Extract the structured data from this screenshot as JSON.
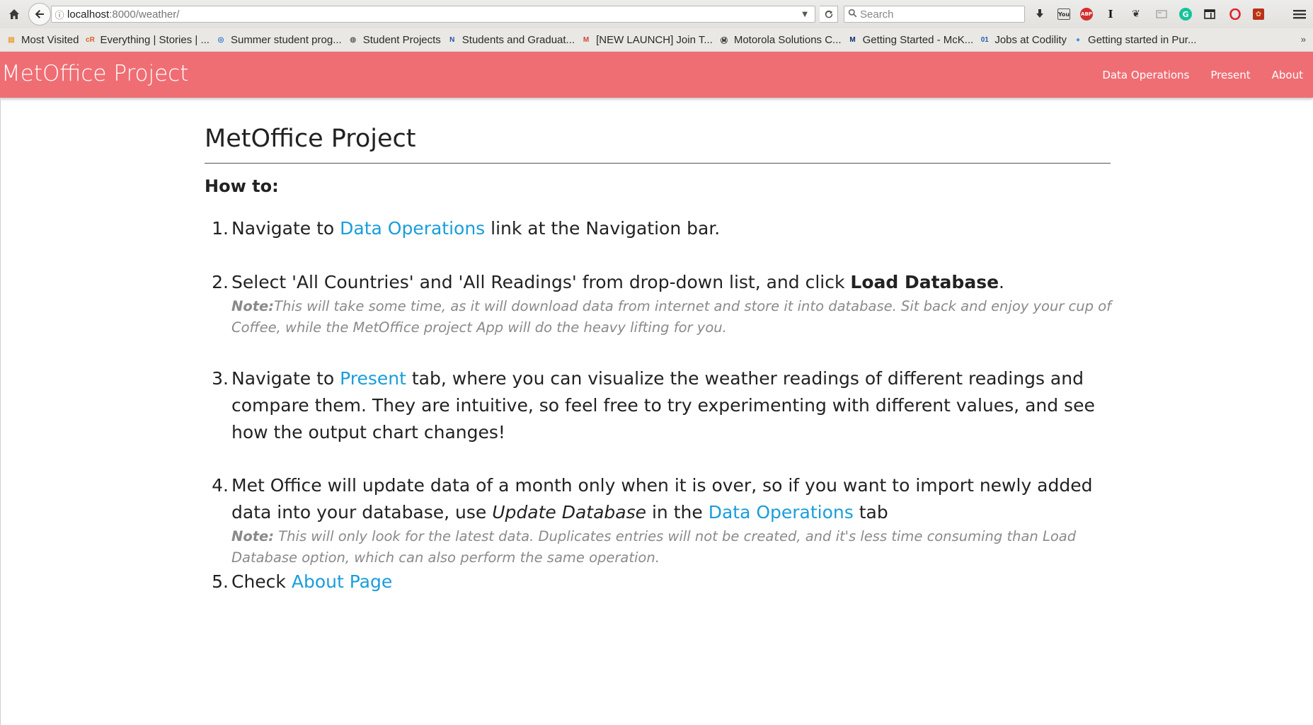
{
  "browser": {
    "url_host": "localhost",
    "url_path": ":8000/weather/",
    "search_placeholder": "Search",
    "bookmarks": [
      {
        "label": "Most Visited",
        "icon": "folder-icon",
        "color": "#e8a030"
      },
      {
        "label": "Everything | Stories | ...",
        "icon": "feed-icon",
        "color": "#e05a2a"
      },
      {
        "label": "Summer student prog...",
        "icon": "globe-icon",
        "color": "#3a7ad0"
      },
      {
        "label": "Student Projects",
        "icon": "globe-gray-icon",
        "color": "#666666"
      },
      {
        "label": "Students and Graduat...",
        "icon": "n-logo-icon",
        "color": "#2b4fa8"
      },
      {
        "label": "[NEW LAUNCH] Join T...",
        "icon": "gmail-icon",
        "color": "#d14836"
      },
      {
        "label": "Motorola Solutions C...",
        "icon": "motorola-icon",
        "color": "#111111"
      },
      {
        "label": "Getting Started - McK...",
        "icon": "mck-icon",
        "color": "#0b2c6b"
      },
      {
        "label": "Jobs at Codility",
        "icon": "codility-icon",
        "color": "#2a5db0"
      },
      {
        "label": "Getting started in Pur...",
        "icon": "globe-blue-icon",
        "color": "#4a90e2"
      }
    ]
  },
  "navbar": {
    "brand": "MetOffice Project",
    "links": [
      "Data Operations",
      "Present",
      "About"
    ],
    "color": "#ef6e74"
  },
  "main": {
    "title": "MetOffice Project",
    "howto": "How to:",
    "steps": [
      {
        "num": "1.",
        "parts": [
          "Navigate to ",
          "Data Operations",
          " link at the Navigation bar."
        ]
      },
      {
        "num": "2.",
        "parts": [
          "Select 'All Countries' and 'All Readings' from drop-down list, and click ",
          "Load Database",
          "."
        ],
        "note_label": "Note:",
        "note_text": "This will take some time, as it will download data from internet and store it into database. Sit back and enjoy your cup of Coffee, while the MetOffice project App will do the heavy lifting for you."
      },
      {
        "num": "3.",
        "parts": [
          "Navigate to ",
          "Present",
          " tab, where you can visualize the weather readings of different readings and compare them. They are intuitive, so feel free to try experimenting with different values, and see how the output chart changes!"
        ]
      },
      {
        "num": "4.",
        "parts": [
          "Met Office will update data of a month only when it is over, so if you want to import newly added data into your database, use ",
          "Update Database",
          " in the ",
          "Data Operations",
          " tab"
        ],
        "note_label": "Note:",
        "note_text": " This will only look for the latest data. Duplicates entries will not be created, and it's less time consuming than Load Database option, which can also perform the same operation."
      },
      {
        "num": "5.",
        "parts": [
          "Check ",
          "About Page"
        ]
      }
    ],
    "link_color": "#1a9ddc"
  }
}
